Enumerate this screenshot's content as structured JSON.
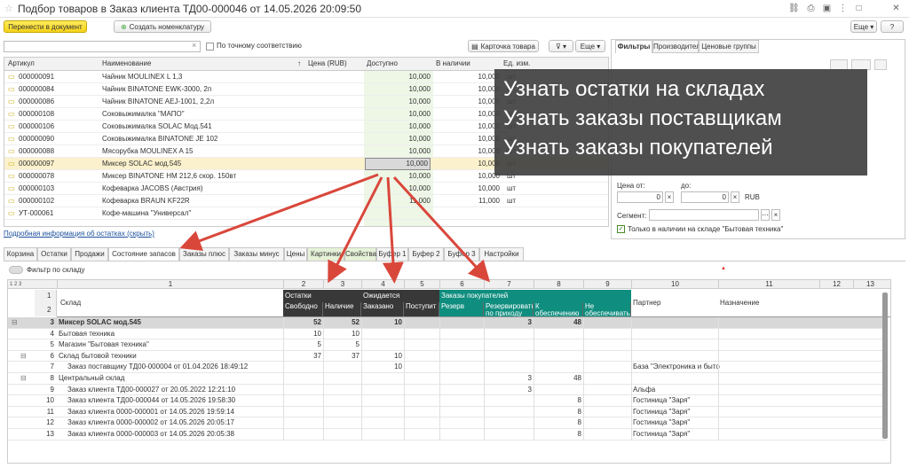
{
  "window": {
    "title": "Подбор товаров в Заказ клиента ТД00-000046 от 14.05.2026 20:09:50"
  },
  "toolbar": {
    "transfer_label": "Перенести в документ",
    "create_label": "Создать номенклатуру",
    "more_label": "Еще"
  },
  "search": {
    "placeholder": "",
    "exact_label": "По точному соответствию",
    "card_label": "Карточка товара",
    "more_label": "Еще"
  },
  "grid": {
    "headers": {
      "article": "Артикул",
      "name": "Наименование",
      "price": "Цена (RUB)",
      "available": "Доступно",
      "instock": "В наличии",
      "unit": "Ед. изм."
    },
    "rows": [
      {
        "article": "000000091",
        "name": "Чайник MOULINEX L 1,3",
        "available": "10,000",
        "instock": "10,000",
        "unit": "шт"
      },
      {
        "article": "000000084",
        "name": "Чайник BINATONE  EWK-3000,  2п",
        "available": "10,000",
        "instock": "10,000",
        "unit": "шт"
      },
      {
        "article": "000000086",
        "name": "Чайник BINATONE  AEJ-1001,  2,2л",
        "available": "10,000",
        "instock": "10,000",
        "unit": "шт"
      },
      {
        "article": "000000108",
        "name": "Соковыжималка \"МАПО\"",
        "available": "10,000",
        "instock": "10,000",
        "unit": "шт"
      },
      {
        "article": "000000106",
        "name": "Соковыжималка  SOLAC  Мод.541",
        "available": "10,000",
        "instock": "10,000",
        "unit": "шт"
      },
      {
        "article": "000000090",
        "name": "Соковыжималка  BINATONE JE 102",
        "available": "10,000",
        "instock": "10,000",
        "unit": "шт"
      },
      {
        "article": "000000088",
        "name": "Мясорубка MOULINEX A 15",
        "available": "10,000",
        "instock": "10,000",
        "unit": "шт"
      },
      {
        "article": "000000097",
        "name": "Миксер SOLAC мод.545",
        "available": "10,000",
        "instock": "10,000",
        "unit": "шт"
      },
      {
        "article": "000000078",
        "name": "Миксер BINATONE HM 212,6 скор. 150вт",
        "available": "10,000",
        "instock": "10,000",
        "unit": "шт"
      },
      {
        "article": "000000103",
        "name": "Кофеварка JACOBS (Австрия)",
        "available": "10,000",
        "instock": "10,000",
        "unit": "шт"
      },
      {
        "article": "000000102",
        "name": "Кофеварка BRAUN KF22R",
        "available": "11,000",
        "instock": "11,000",
        "unit": "шт"
      },
      {
        "article": "УТ-000061",
        "name": "Кофе-машина \"Универсал\"",
        "available": "",
        "instock": "",
        "unit": ""
      }
    ],
    "selected_row": 7
  },
  "details_link": "Подробная информация об остатках (скрыть)",
  "right_panel": {
    "tabs": [
      "Фильтры",
      "Производители",
      "Ценовые группы"
    ],
    "price_from": "Цена от:",
    "price_to": "до:",
    "price_from_val": "0",
    "price_to_val": "0",
    "currency": "RUB",
    "segment": "Сегмент:",
    "instock_only": "Только в наличии на складе \"Бытовая техника\""
  },
  "overlay": {
    "line1": "Узнать остатки на складах",
    "line2": "Узнать заказы поставщикам",
    "line3": "Узнать заказы покупателей"
  },
  "bottom_tabs": [
    "Корзина",
    "Остатки",
    "Продажи",
    "Состояние запасов",
    "Заказы плюс",
    "Заказы минус",
    "Цены",
    "Картинки",
    "Свойства",
    "Буфер 1",
    "Буфер 2",
    "Буфер 3",
    "Настройки"
  ],
  "filter_label": "Фильтр по складу",
  "report": {
    "colnums": [
      "1",
      "2",
      "3",
      "4",
      "5",
      "6",
      "7",
      "8",
      "9",
      "10",
      "11",
      "12",
      "13"
    ],
    "groups": {
      "stock": "Остатки",
      "expected": "Ожидается",
      "orders": "Заказы покупателей"
    },
    "sub": {
      "warehouse": "Склад",
      "free": "Свободно",
      "onhand": "Наличие",
      "ordered": "Заказано",
      "arrived": "Поступит",
      "reserve": "Резерв",
      "reserve_arr": "Резервировать по приходу",
      "to_provide": "К обеспечению",
      "not_provide": "Не обеспечивать",
      "partner": "Партнер",
      "purpose": "Назначение"
    },
    "rows": [
      {
        "n": "3",
        "name": "Миксер SOLAC мод.545",
        "free": "52",
        "onhand": "52",
        "ordered": "10",
        "arrived": "",
        "reserve": "",
        "rarr": "3",
        "prov": "48",
        "nprov": "",
        "partner": "",
        "bold": true
      },
      {
        "n": "4",
        "name": "Бытовая техника",
        "free": "10",
        "onhand": "10",
        "ordered": "",
        "arrived": "",
        "reserve": "",
        "rarr": "",
        "prov": "",
        "nprov": "",
        "partner": ""
      },
      {
        "n": "5",
        "name": "Магазин \"Бытовая техника\"",
        "free": "5",
        "onhand": "5",
        "ordered": "",
        "arrived": "",
        "reserve": "",
        "rarr": "",
        "prov": "",
        "nprov": "",
        "partner": ""
      },
      {
        "n": "6",
        "name": "Склад бытовой техники",
        "free": "37",
        "onhand": "37",
        "ordered": "10",
        "arrived": "",
        "reserve": "",
        "rarr": "",
        "prov": "",
        "nprov": "",
        "partner": ""
      },
      {
        "n": "7",
        "name": "Заказ поставщику ТД00-000004 от 01.04.2026 18:49:12",
        "free": "",
        "onhand": "",
        "ordered": "10",
        "arrived": "",
        "reserve": "",
        "rarr": "",
        "prov": "",
        "nprov": "",
        "partner": "База \"Электроника и быто"
      },
      {
        "n": "8",
        "name": "Центральный склад",
        "free": "",
        "onhand": "",
        "ordered": "",
        "arrived": "",
        "reserve": "",
        "rarr": "3",
        "prov": "48",
        "nprov": "",
        "partner": ""
      },
      {
        "n": "9",
        "name": "Заказ клиента ТД00-000027 от 20.05.2022 12:21:10",
        "free": "",
        "onhand": "",
        "ordered": "",
        "arrived": "",
        "reserve": "",
        "rarr": "3",
        "prov": "",
        "nprov": "",
        "partner": "Альфа"
      },
      {
        "n": "10",
        "name": "Заказ клиента ТД00-000044 от 14.05.2026 19:58:30",
        "free": "",
        "onhand": "",
        "ordered": "",
        "arrived": "",
        "reserve": "",
        "rarr": "",
        "prov": "8",
        "nprov": "",
        "partner": "Гостиница \"Заря\""
      },
      {
        "n": "11",
        "name": "Заказ клиента 0000-000001 от 14.05.2026 19:59:14",
        "free": "",
        "onhand": "",
        "ordered": "",
        "arrived": "",
        "reserve": "",
        "rarr": "",
        "prov": "8",
        "nprov": "",
        "partner": "Гостиница \"Заря\""
      },
      {
        "n": "12",
        "name": "Заказ клиента 0000-000002 от 14.05.2026 20:05:17",
        "free": "",
        "onhand": "",
        "ordered": "",
        "arrived": "",
        "reserve": "",
        "rarr": "",
        "prov": "8",
        "nprov": "",
        "partner": "Гостиница \"Заря\""
      },
      {
        "n": "13",
        "name": "Заказ клиента 0000-000003 от 14.05.2026 20:05:38",
        "free": "",
        "onhand": "",
        "ordered": "",
        "arrived": "",
        "reserve": "",
        "rarr": "",
        "prov": "8",
        "nprov": "",
        "partner": "Гостиница \"Заря\""
      }
    ]
  }
}
